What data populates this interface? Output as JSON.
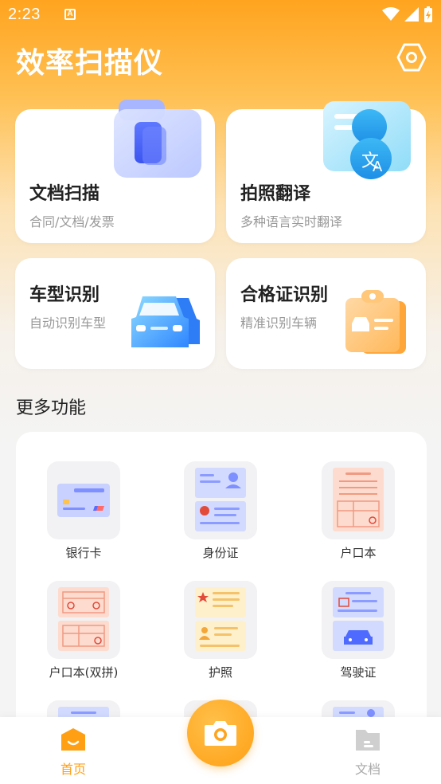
{
  "status_bar": {
    "time": "2:23",
    "notification_icon": "A"
  },
  "header": {
    "title": "效率扫描仪",
    "settings_icon": "hexagon-settings-icon"
  },
  "feature_cards": [
    {
      "title": "文档扫描",
      "subtitle": "合同/文档/发票",
      "icon": "document-stack-icon"
    },
    {
      "title": "拍照翻译",
      "subtitle": "多种语言实时翻译",
      "icon": "translate-icon"
    },
    {
      "title": "车型识别",
      "subtitle": "自动识别车型",
      "icon": "car-icon"
    },
    {
      "title": "合格证识别",
      "subtitle": "精准识别车辆",
      "icon": "clipboard-certificate-icon"
    }
  ],
  "more_section": {
    "title": "更多功能",
    "tools": [
      {
        "label": "银行卡",
        "icon": "bank-card-icon"
      },
      {
        "label": "身份证",
        "icon": "id-card-icon"
      },
      {
        "label": "户口本",
        "icon": "household-register-icon"
      },
      {
        "label": "户口本(双拼)",
        "icon": "household-register-double-icon"
      },
      {
        "label": "护照",
        "icon": "passport-icon"
      },
      {
        "label": "驾驶证",
        "icon": "driver-license-icon"
      }
    ]
  },
  "bottom_nav": {
    "home_label": "首页",
    "docs_label": "文档",
    "camera_icon": "camera-icon"
  },
  "colors": {
    "accent": "#FFA41F",
    "nav_active": "#FF9F14",
    "nav_inactive": "#AAAAAA",
    "icon_blue": "#4F6BFF"
  }
}
